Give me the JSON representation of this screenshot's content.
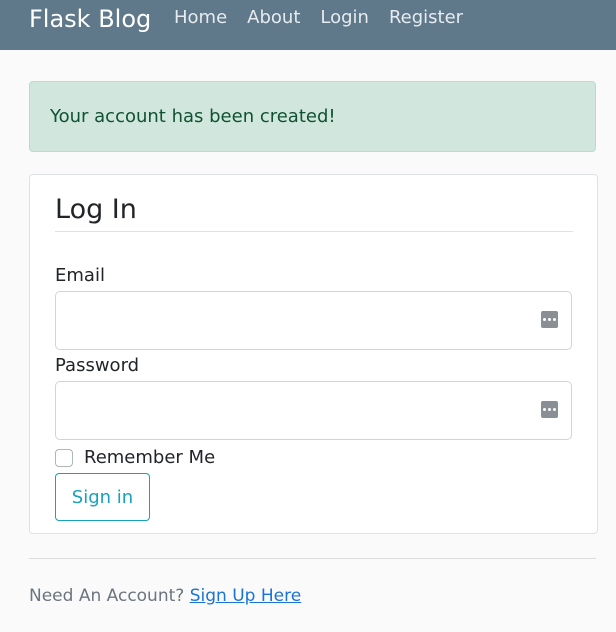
{
  "navbar": {
    "brand": "Flask Blog",
    "links": [
      "Home",
      "About",
      "Login",
      "Register"
    ],
    "background": "#5f788a"
  },
  "alert": {
    "message": "Your account has been created!",
    "background": "#d1e7dd"
  },
  "form": {
    "legend": "Log In",
    "email_label": "Email",
    "email_value": "",
    "password_label": "Password",
    "password_value": "",
    "remember_label": "Remember Me",
    "remember_checked": false,
    "submit_label": "Sign in",
    "field_icon": "password-manager-icon"
  },
  "footer": {
    "prompt": "Need An Account?",
    "link": "Sign Up Here"
  }
}
